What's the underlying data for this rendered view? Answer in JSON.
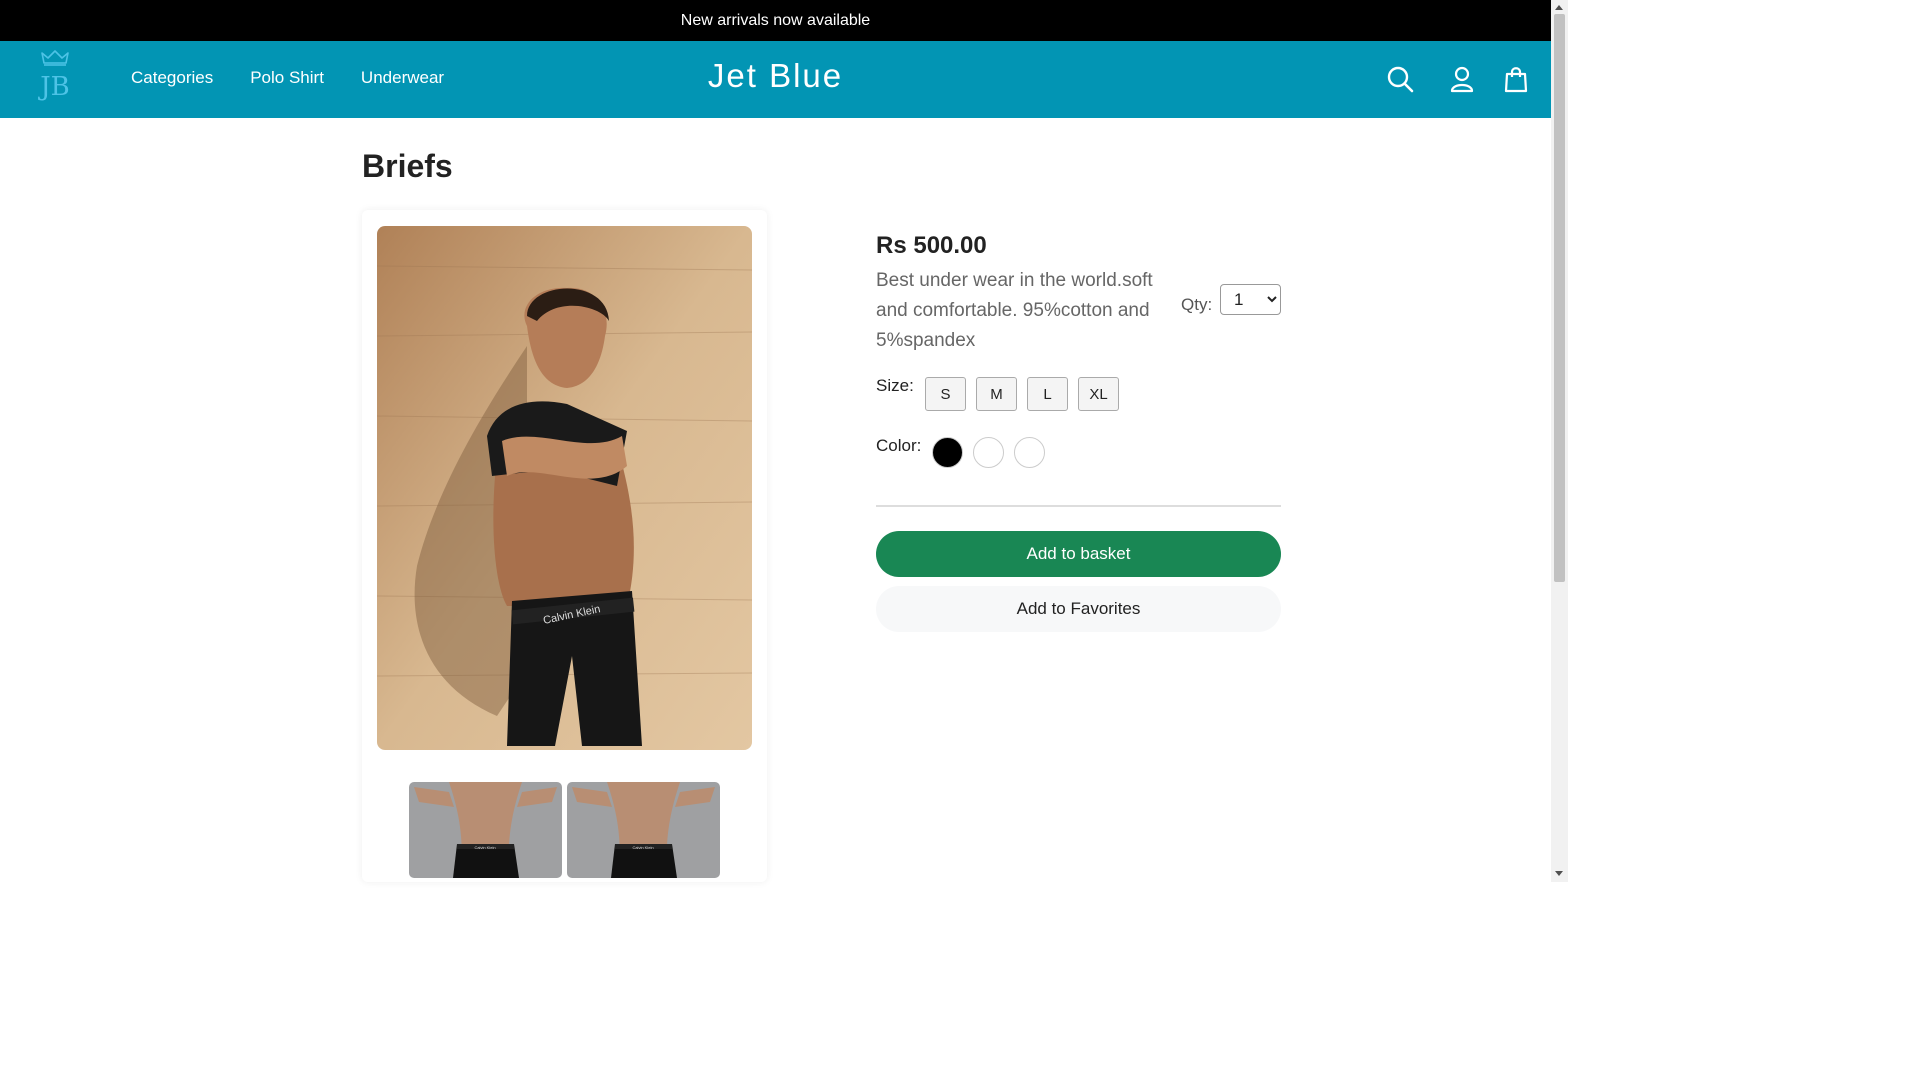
{
  "announcement": "New arrivals now available",
  "header": {
    "logo_text": "JB",
    "brand": "Jet Blue",
    "nav": [
      "Categories",
      "Polo Shirt",
      "Underwear"
    ],
    "icons": [
      "search-icon",
      "user-icon",
      "shopping-bag-icon"
    ],
    "bg_color": "#0295b4"
  },
  "product": {
    "title": "Briefs",
    "price": "Rs 500.00",
    "description": "Best under wear in the world.soft and comfortable. 95%cotton and 5%spandex",
    "qty_label": "Qty:",
    "qty_value": "1",
    "size_label": "Size:",
    "sizes": [
      "S",
      "M",
      "L",
      "XL"
    ],
    "color_label": "Color:",
    "colors": [
      "#000000",
      "#ffffff",
      "#ffffff"
    ],
    "add_to_basket": "Add to basket",
    "add_to_favorites": "Add to Favorites",
    "basket_color": "#198754",
    "main_image_brand": "Calvin Klein",
    "thumbnail_brand": "Calvin Klein"
  }
}
